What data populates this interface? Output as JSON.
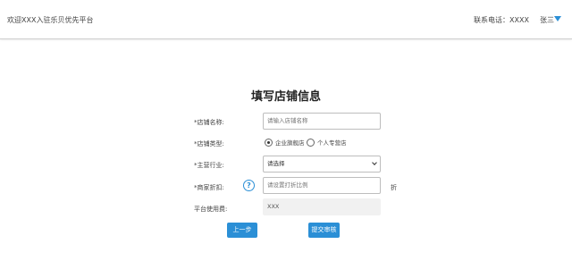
{
  "header": {
    "welcome": "欢迎XXX入驻乐贝优先平台",
    "phone_label": "联系电话：XXXX",
    "user_name": "张三",
    "accent_color": "#2b8fd6"
  },
  "form": {
    "title": "填写店铺信息",
    "shop_name": {
      "label": "*店铺名称:",
      "value": "",
      "placeholder": "请输入店铺名称"
    },
    "shop_type": {
      "label": "*店铺类型:",
      "options": [
        "企业旗舰店",
        "个人专营店"
      ],
      "selected": "企业旗舰店"
    },
    "industry": {
      "label": "*主营行业:",
      "selected": "请选择"
    },
    "discount": {
      "label": "*商家折扣:",
      "help_icon": "question-circle-icon",
      "value": "",
      "placeholder": "请设置打折比例",
      "suffix": "折"
    },
    "platform_fee": {
      "label": "平台使用费:",
      "value": "XXX"
    }
  },
  "actions": {
    "prev_label": "上一步",
    "submit_label": "提交审核"
  }
}
